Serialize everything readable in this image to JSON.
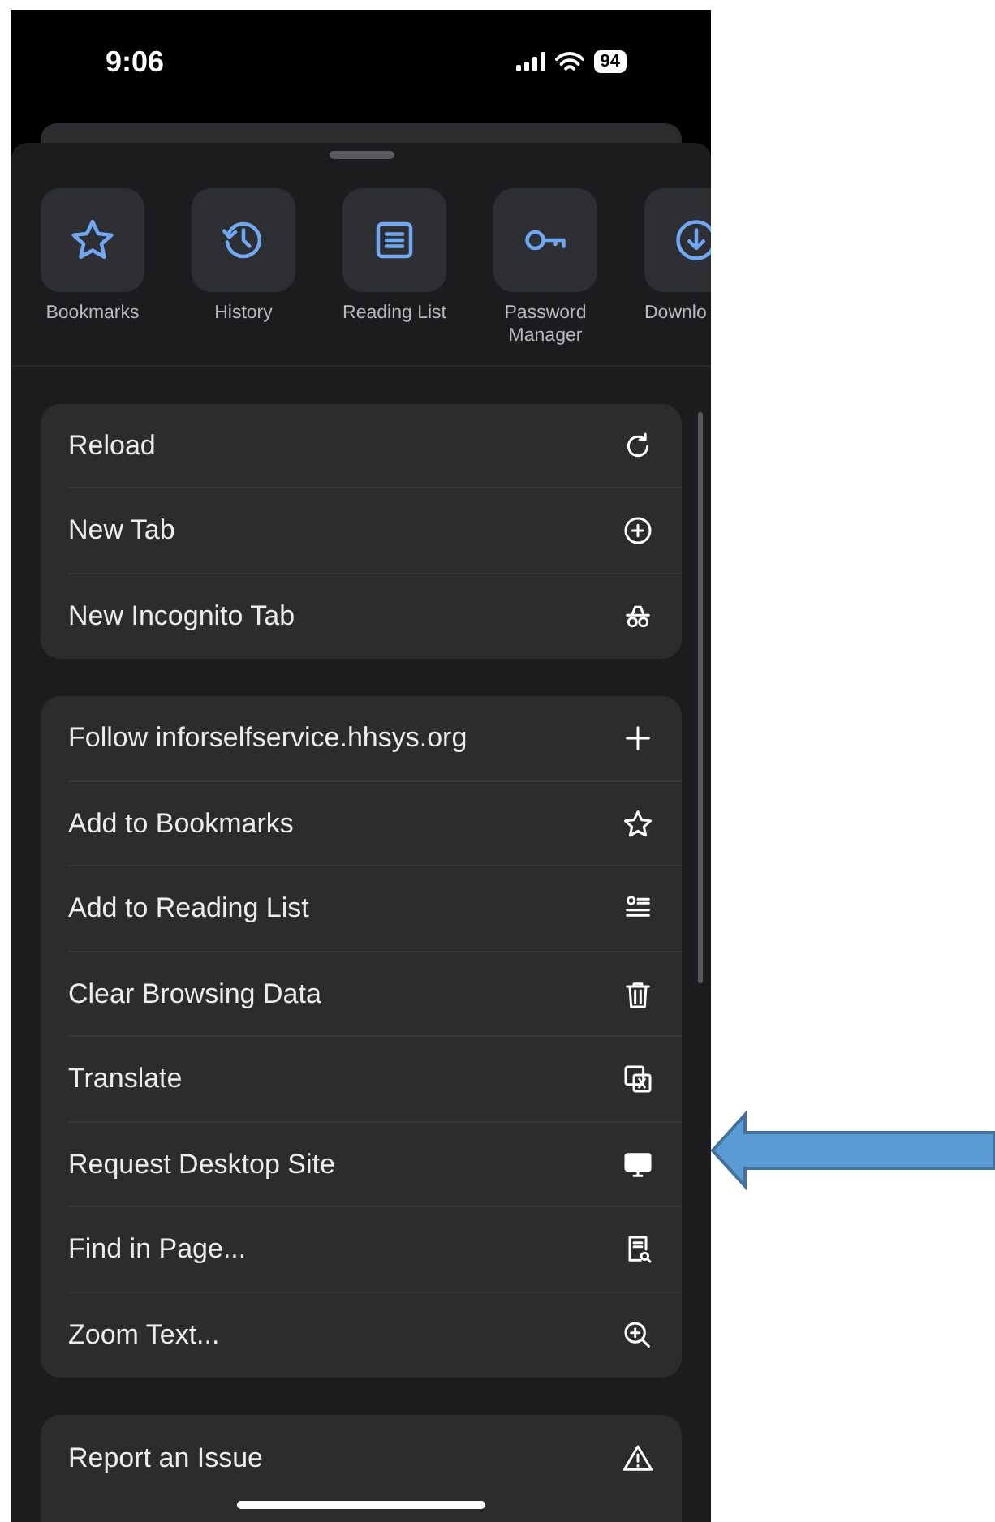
{
  "status_bar": {
    "time": "9:06",
    "battery": "94"
  },
  "shortcuts": [
    {
      "label": "Bookmarks",
      "kind": "star"
    },
    {
      "label": "History",
      "kind": "history"
    },
    {
      "label": "Reading List",
      "kind": "list"
    },
    {
      "label": "Password Manager",
      "kind": "key"
    },
    {
      "label": "Downlo",
      "kind": "download"
    }
  ],
  "menu_groups": [
    [
      {
        "label": "Reload",
        "kind": "reload"
      },
      {
        "label": "New Tab",
        "kind": "plus-circle"
      },
      {
        "label": "New Incognito Tab",
        "kind": "incognito"
      }
    ],
    [
      {
        "label": "Follow inforselfservice.hhsys.org",
        "kind": "plus"
      },
      {
        "label": "Add to Bookmarks",
        "kind": "star"
      },
      {
        "label": "Add to Reading List",
        "kind": "list-add"
      },
      {
        "label": "Clear Browsing Data",
        "kind": "trash"
      },
      {
        "label": "Translate",
        "kind": "translate"
      },
      {
        "label": "Request Desktop Site",
        "kind": "desktop"
      },
      {
        "label": "Find in Page...",
        "kind": "find"
      },
      {
        "label": "Zoom Text...",
        "kind": "zoom"
      }
    ],
    [
      {
        "label": "Report an Issue",
        "kind": "warning"
      }
    ]
  ]
}
